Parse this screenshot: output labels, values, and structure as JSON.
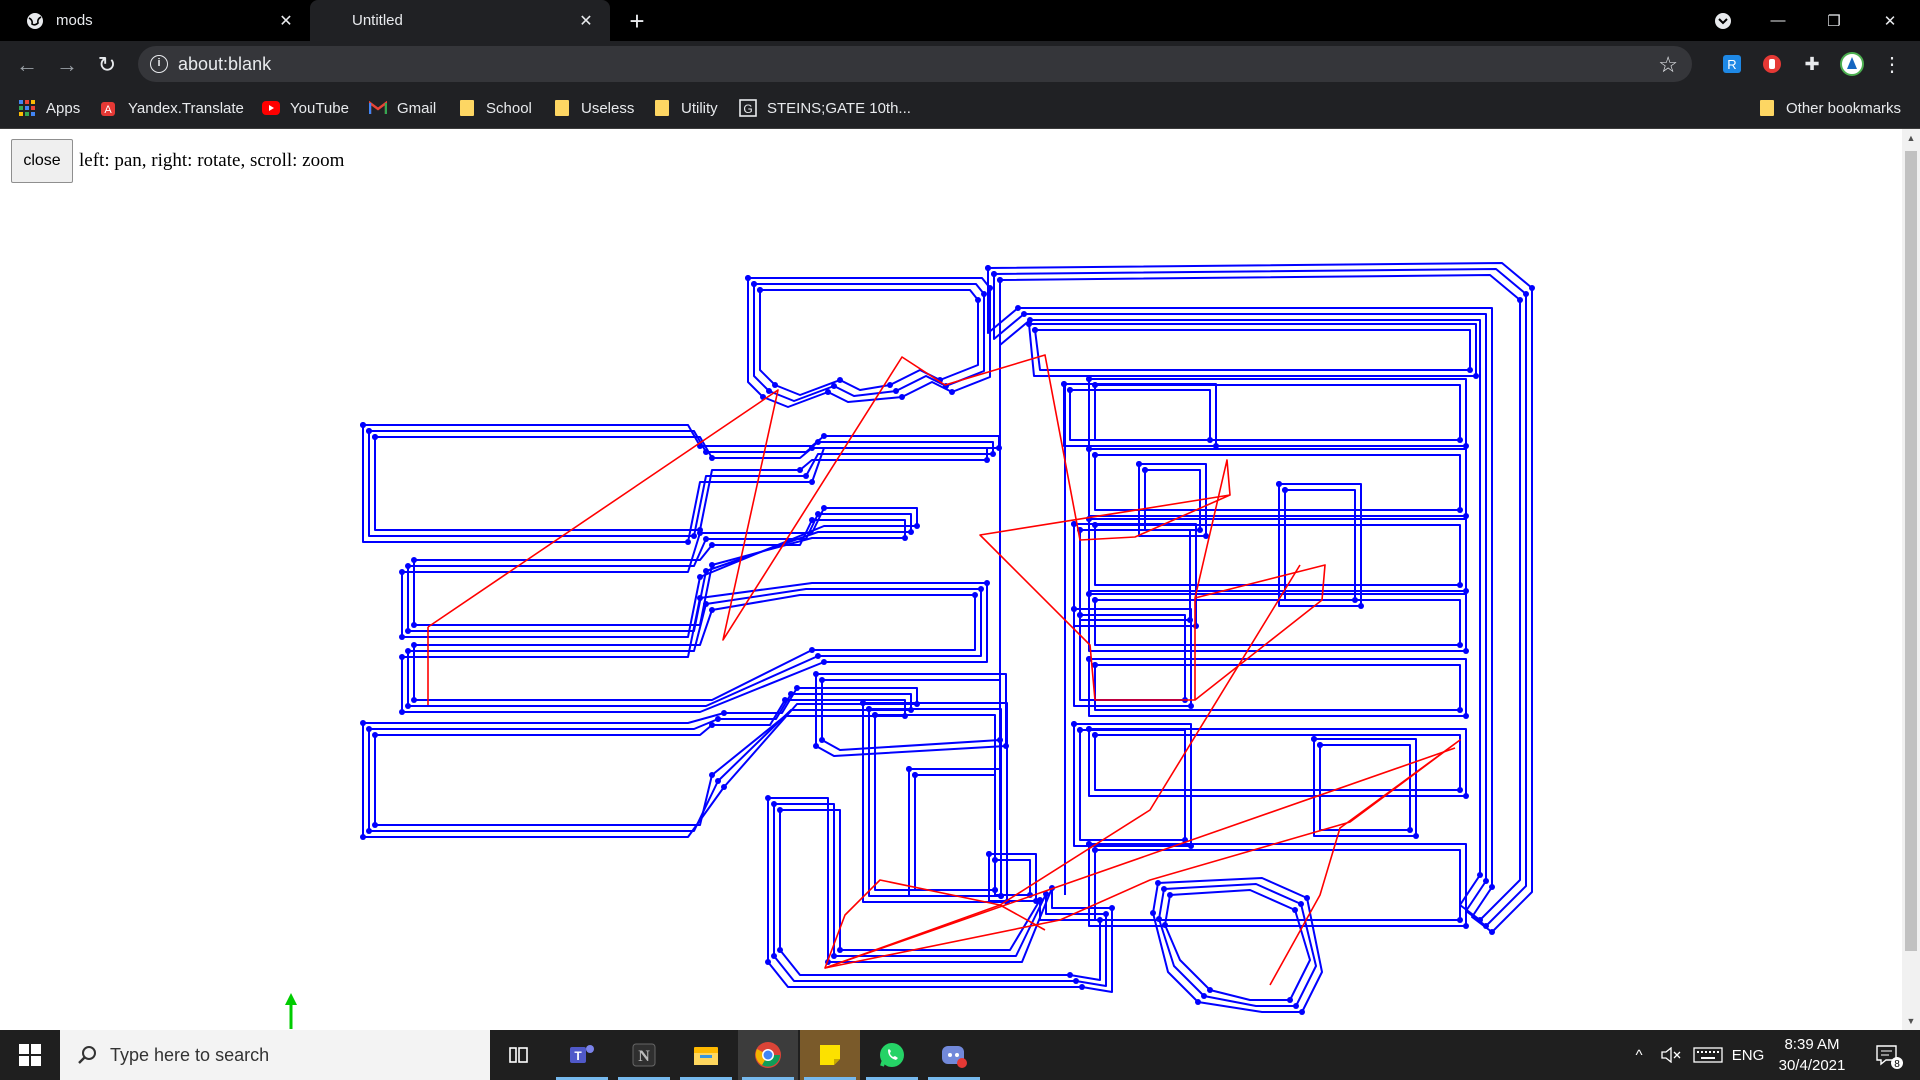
{
  "browser": {
    "tabs": [
      {
        "title": "mods",
        "active": false
      },
      {
        "title": "Untitled",
        "active": true
      }
    ],
    "url": "about:blank",
    "bookmarks": [
      {
        "label": "Apps",
        "icon": "apps-grid-icon"
      },
      {
        "label": "Yandex.Translate",
        "icon": "yandex-translate-icon"
      },
      {
        "label": "YouTube",
        "icon": "youtube-icon"
      },
      {
        "label": "Gmail",
        "icon": "gmail-icon"
      },
      {
        "label": "School",
        "icon": "folder-icon"
      },
      {
        "label": "Useless",
        "icon": "folder-icon"
      },
      {
        "label": "Utility",
        "icon": "folder-icon"
      },
      {
        "label": "STEINS;GATE 10th...",
        "icon": "steinsgate-icon"
      }
    ],
    "other_bookmarks": "Other bookmarks"
  },
  "page": {
    "close_label": "close",
    "hint": "left: pan, right: rotate, scroll: zoom",
    "toolpath_color": "#0000ff",
    "rapid_move_color": "#ff0000",
    "axis_color": "#00cc00"
  },
  "taskbar": {
    "search_placeholder": "Type here to search",
    "apps": [
      "task-view-icon",
      "teams-icon",
      "notion-icon",
      "file-explorer-icon",
      "chrome-icon",
      "sticky-notes-icon",
      "whatsapp-icon",
      "discord-icon"
    ],
    "language": "ENG",
    "time": "8:39 AM",
    "date": "30/4/2021",
    "notification_count": "8"
  }
}
